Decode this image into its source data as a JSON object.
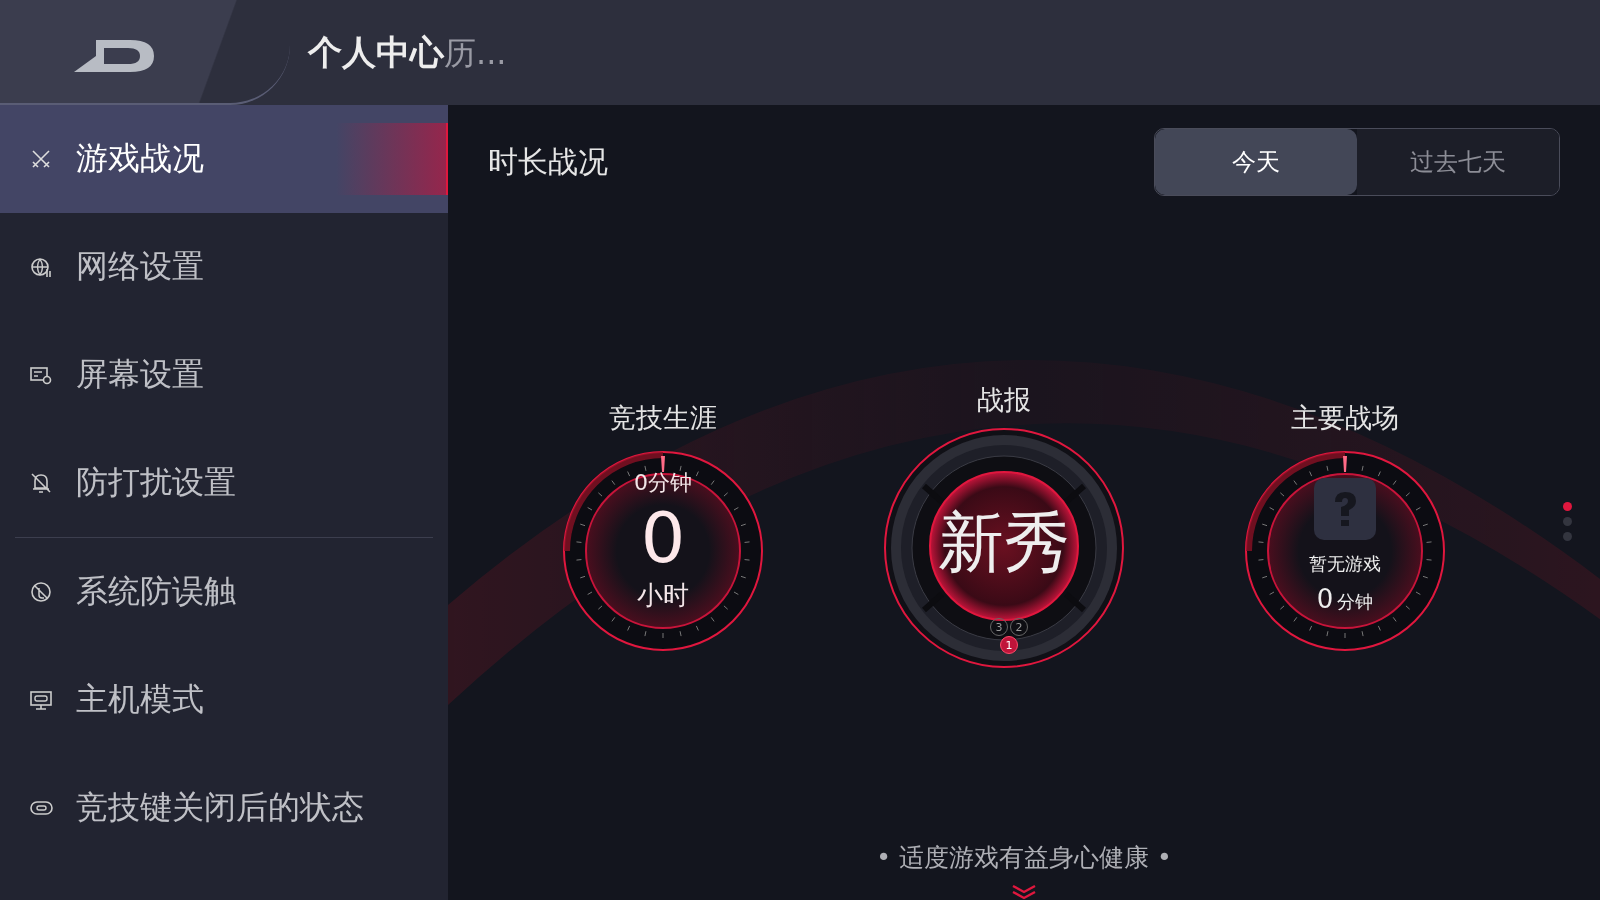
{
  "header": {
    "title": "个人中心",
    "title_overflow": "历..."
  },
  "sidebar": {
    "items": [
      {
        "label": "游戏战况",
        "selected": true
      },
      {
        "label": "网络设置",
        "selected": false
      },
      {
        "label": "屏幕设置",
        "selected": false
      },
      {
        "label": "防打扰设置",
        "selected": false,
        "divider_after": true
      },
      {
        "label": "系统防误触",
        "selected": false
      },
      {
        "label": "主机模式",
        "selected": false
      },
      {
        "label": "竞技键关闭后的状态",
        "selected": false
      }
    ]
  },
  "main": {
    "title": "时长战况",
    "period_tabs": [
      {
        "label": "今天",
        "selected": true
      },
      {
        "label": "过去七天",
        "selected": false
      }
    ],
    "career": {
      "title": "竞技生涯",
      "minutes": "0分钟",
      "hours": "0",
      "hours_unit": "小时"
    },
    "report": {
      "title": "战报",
      "rank": "新秀",
      "markers": [
        {
          "label": "3",
          "selected": false
        },
        {
          "label": "2",
          "selected": false
        },
        {
          "label": "1",
          "selected": true
        }
      ]
    },
    "battlefield": {
      "title": "主要战场",
      "game": "暂无游戏",
      "minutes": "0",
      "minutes_unit": "分钟"
    },
    "pages": [
      {
        "selected": true
      },
      {
        "selected": false
      },
      {
        "selected": false
      }
    ],
    "footer": "• 适度游戏有益身心健康 •"
  }
}
